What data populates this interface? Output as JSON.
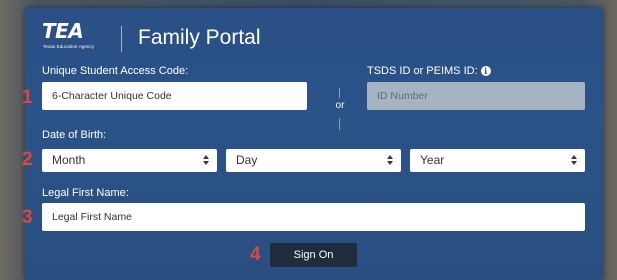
{
  "header": {
    "logo_text": "TEA",
    "logo_subtext": "Texas Education Agency",
    "title": "Family Portal"
  },
  "access_code": {
    "label": "Unique Student Access Code:",
    "placeholder": "6-Character Unique Code"
  },
  "separator": {
    "or_label": "or"
  },
  "tsds": {
    "label": "TSDS ID or PEIMS ID:",
    "placeholder": "ID Number"
  },
  "dob": {
    "label": "Date of Birth:",
    "month": "Month",
    "day": "Day",
    "year": "Year"
  },
  "first_name": {
    "label": "Legal First Name:",
    "placeholder": "Legal First Name"
  },
  "sign_on_label": "Sign On",
  "markers": [
    "1",
    "2",
    "3",
    "4"
  ],
  "colors": {
    "panel": "#2a4f86",
    "marker": "#e0473b",
    "button": "#1f2c3b",
    "disabled_input": "#a6b3c2"
  },
  "icons": [
    "info-icon",
    "select-caret-icon"
  ]
}
